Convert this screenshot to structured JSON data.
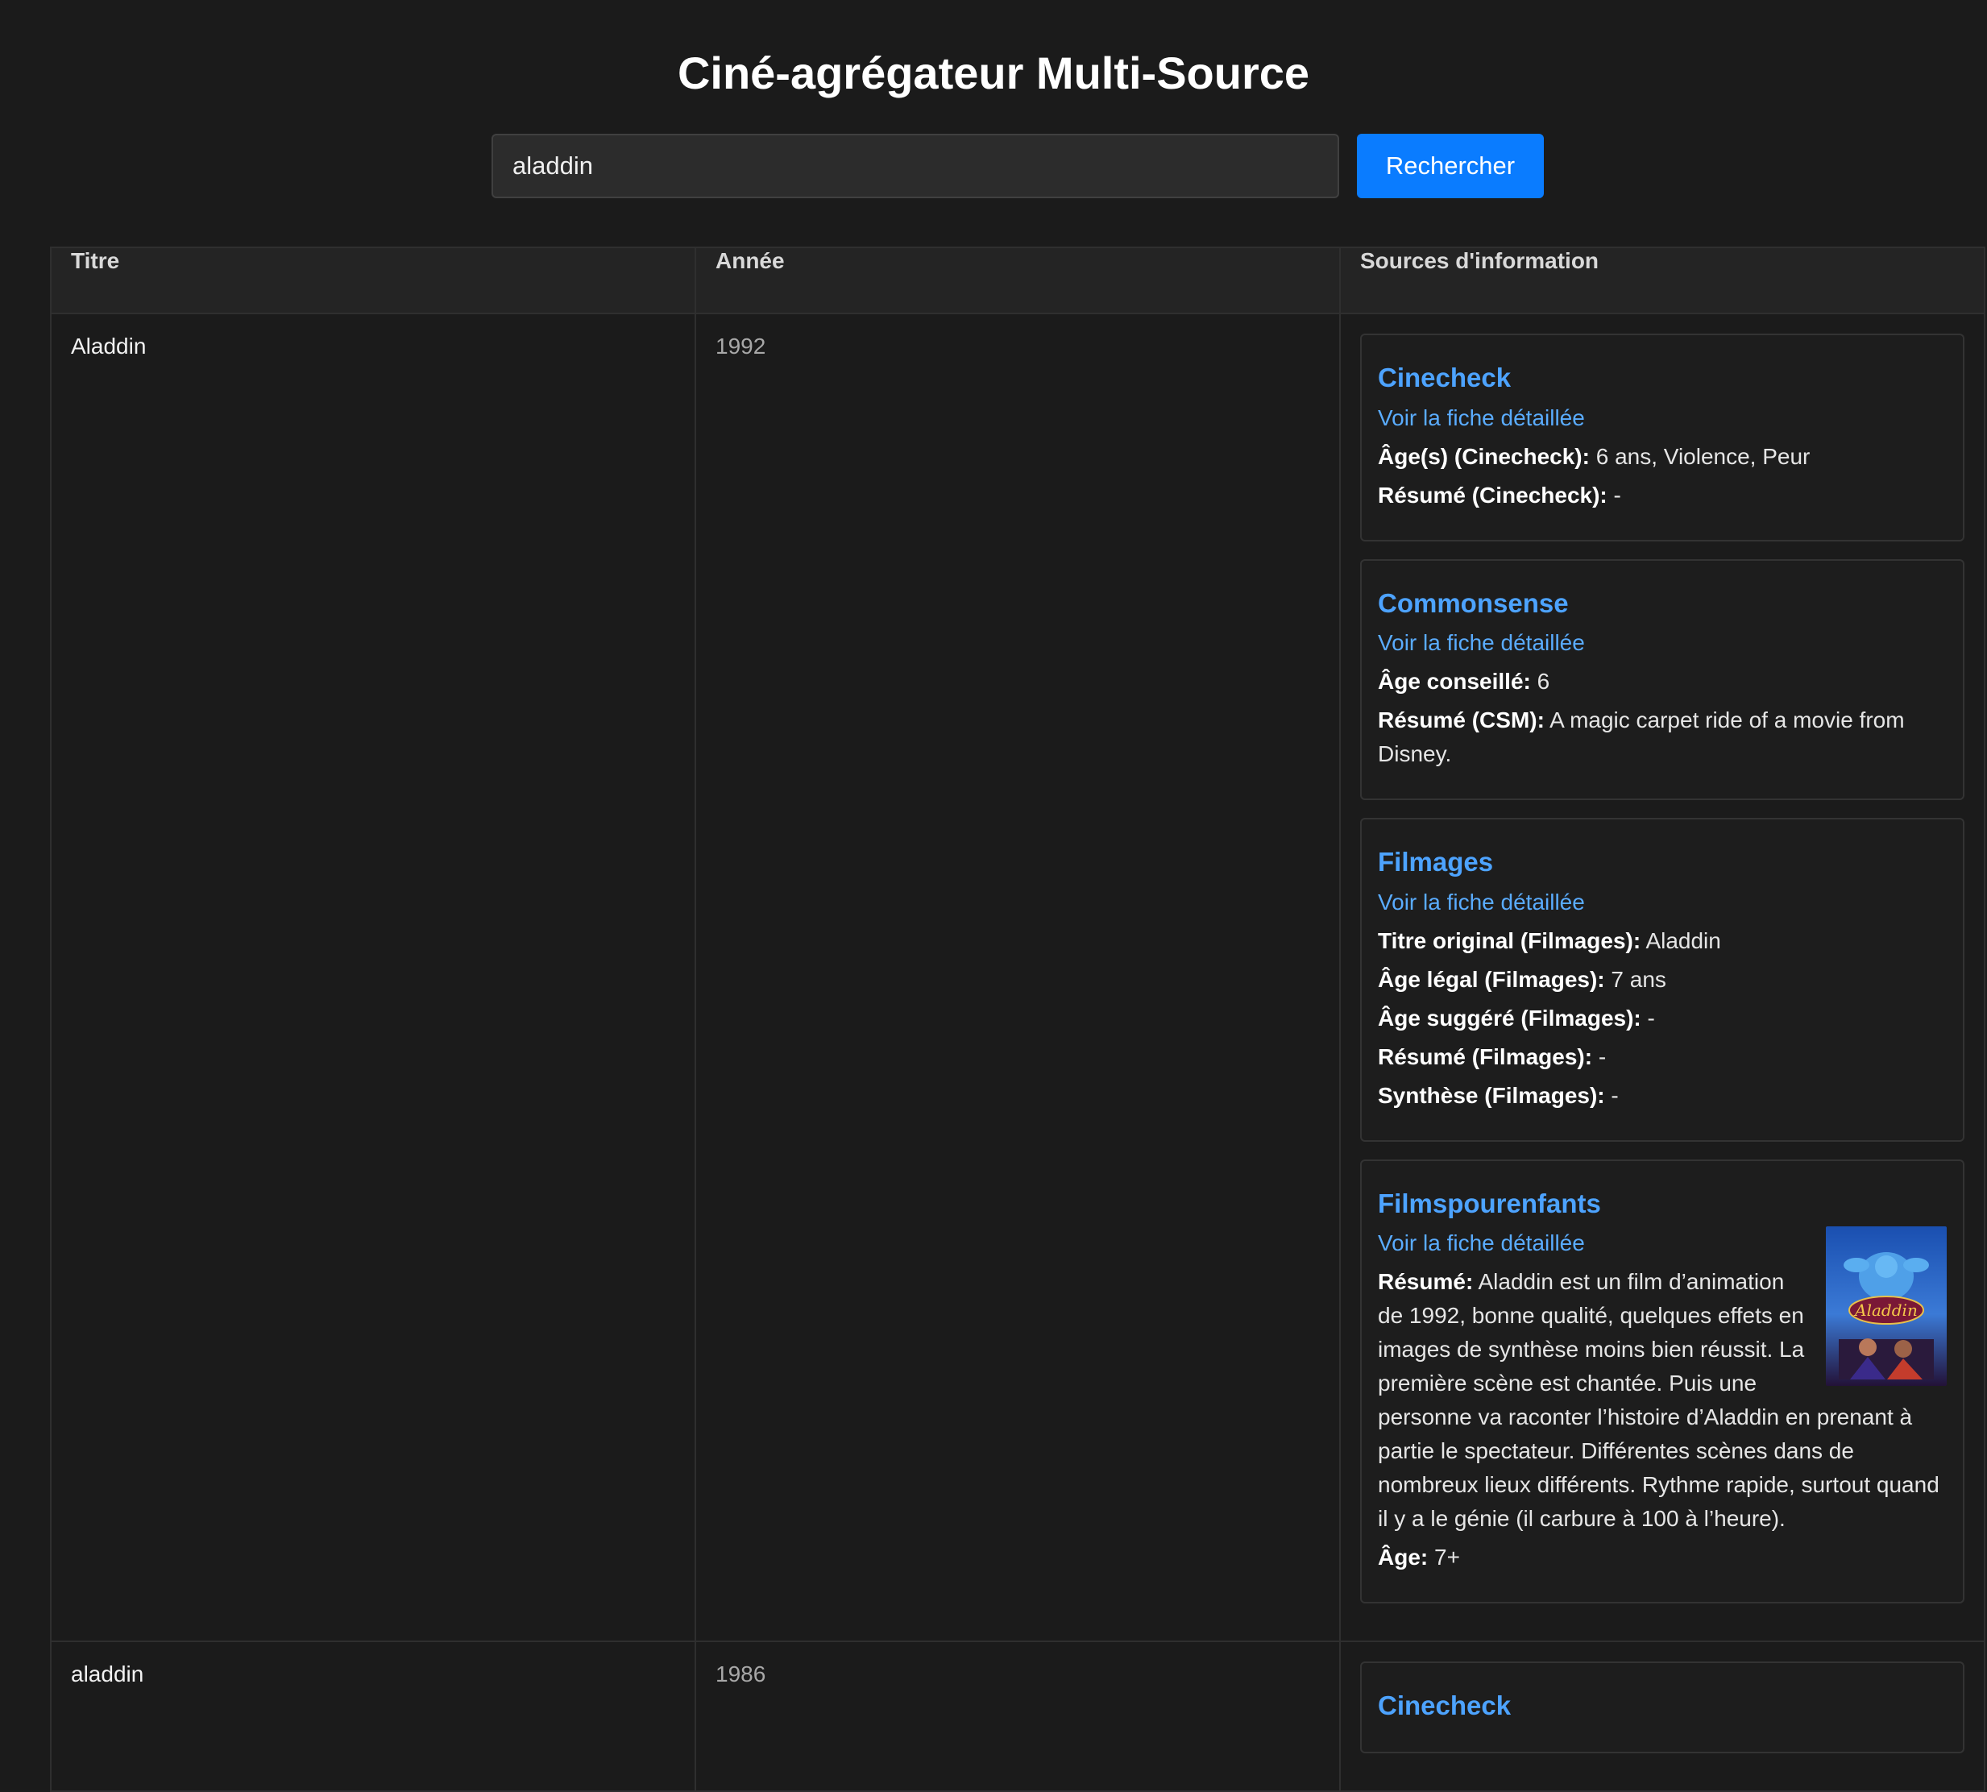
{
  "app": {
    "title": "Ciné-agrégateur Multi-Source"
  },
  "search": {
    "value": "aladdin",
    "button_label": "Rechercher"
  },
  "table": {
    "headers": [
      "Titre",
      "Année",
      "Sources d'information"
    ],
    "rows": [
      {
        "title": "Aladdin",
        "year": "1992",
        "sources": {
          "cinecheck": {
            "name": "Cinecheck",
            "link": "Voir la fiche détaillée",
            "age_label": "Âge(s) (Cinecheck):",
            "age_value": " 6 ans, Violence, Peur",
            "summary_label": "Résumé (Cinecheck):",
            "summary_value": " -"
          },
          "commonsense": {
            "name": "Commonsense",
            "link": "Voir la fiche détaillée",
            "age_label": "Âge conseillé:",
            "age_value": " 6",
            "summary_label": "Résumé (CSM):",
            "summary_value": " A magic carpet ride of a movie from Disney."
          },
          "filmages": {
            "name": "Filmages",
            "link": "Voir la fiche détaillée",
            "original_title_label": "Titre original (Filmages):",
            "original_title_value": " Aladdin",
            "legal_age_label": "Âge légal (Filmages):",
            "legal_age_value": " 7 ans",
            "suggested_age_label": "Âge suggéré (Filmages):",
            "suggested_age_value": " -",
            "summary_label": "Résumé (Filmages):",
            "summary_value": " -",
            "synthesis_label": "Synthèse (Filmages):",
            "synthesis_value": " -"
          },
          "filmspourenfants": {
            "name": "Filmspourenfants",
            "link": "Voir la fiche détaillée",
            "summary_label": "Résumé:",
            "summary_value": " Aladdin est un film d’animation de 1992, bonne qualité, quelques effets en images de synthèse moins bien réussit. La première scène est chantée. Puis une personne va raconter l’histoire d’Aladdin en prenant à partie le spectateur. Différentes scènes dans de nombreux lieux différents. Rythme rapide, surtout quand il y a le génie (il carbure à 100 à l’heure).",
            "age_label": "Âge:",
            "age_value": " 7+",
            "poster_text": "Aladdin"
          }
        }
      },
      {
        "title": "aladdin",
        "year": "1986",
        "sources": {
          "cinecheck": {
            "name": "Cinecheck"
          }
        }
      }
    ]
  },
  "colors": {
    "background": "#1b1b1b",
    "accent": "#0a7cff",
    "link": "#4da3ff"
  }
}
